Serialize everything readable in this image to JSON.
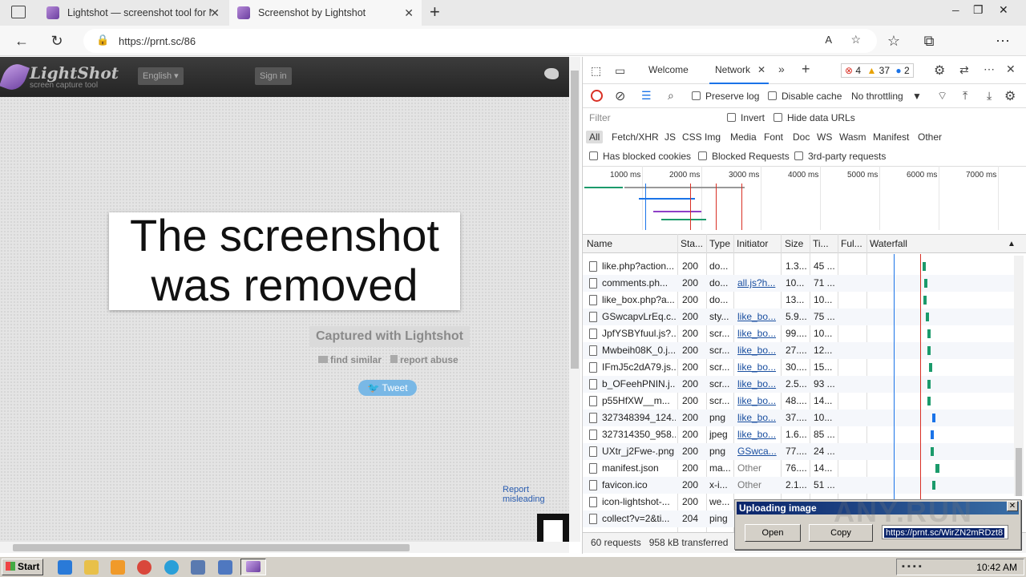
{
  "browser": {
    "tabs": [
      {
        "title": "Lightshot — screenshot tool for M",
        "close": "✕"
      },
      {
        "title": "Screenshot by Lightshot",
        "close": "✕"
      }
    ],
    "new_tab": "+",
    "url": "https://prnt.sc/86",
    "window_controls": [
      "─",
      "❐",
      "✕"
    ]
  },
  "lightshot": {
    "logo": "LightShot",
    "tagline": "screen capture tool",
    "language": "English",
    "sign_in": "Sign in",
    "removed_message_line1": "The screenshot",
    "removed_message_line2": "was removed",
    "captured_with": "Captured with Lightshot",
    "find_similar": "find similar",
    "report_abuse": "report abuse",
    "tweet": "Tweet",
    "report_misleading": "Report misleading"
  },
  "devtools": {
    "tabs": [
      "Welcome",
      "Network"
    ],
    "errors": "4",
    "warnings": "37",
    "info": "2",
    "toolbar": {
      "preserve_log": "Preserve log",
      "disable_cache": "Disable cache",
      "throttling": "No throttling"
    },
    "filter": {
      "placeholder": "Filter",
      "invert": "Invert",
      "hide_data_urls": "Hide data URLs",
      "types": [
        "All",
        "Fetch/XHR",
        "JS",
        "CSS",
        "Img",
        "Media",
        "Font",
        "Doc",
        "WS",
        "Wasm",
        "Manifest",
        "Other"
      ],
      "has_blocked_cookies": "Has blocked cookies",
      "blocked_requests": "Blocked Requests",
      "third_party": "3rd-party requests"
    },
    "overview_ticks": [
      "1000 ms",
      "2000 ms",
      "3000 ms",
      "4000 ms",
      "5000 ms",
      "6000 ms",
      "7000 ms"
    ],
    "columns": [
      "Name",
      "Sta...",
      "Type",
      "Initiator",
      "Size",
      "Ti...",
      "Ful...",
      "Waterfall"
    ],
    "rows": [
      {
        "name": "like.php?action...",
        "status": "200",
        "type": "do...",
        "initiator": "",
        "size": "1.3...",
        "time": "45 ..."
      },
      {
        "name": "comments.ph...",
        "status": "200",
        "type": "do...",
        "initiator": "all.js?h...",
        "size": "10...",
        "time": "71 ..."
      },
      {
        "name": "like_box.php?a...",
        "status": "200",
        "type": "do...",
        "initiator": "",
        "size": "13...",
        "time": "10..."
      },
      {
        "name": "GSwcapvLrEq.c...",
        "status": "200",
        "type": "sty...",
        "initiator": "like_bo...",
        "size": "5.9...",
        "time": "75 ..."
      },
      {
        "name": "JpfYSBYfuul.js?...",
        "status": "200",
        "type": "scr...",
        "initiator": "like_bo...",
        "size": "99....",
        "time": "10..."
      },
      {
        "name": "Mwbeih08K_0.j...",
        "status": "200",
        "type": "scr...",
        "initiator": "like_bo...",
        "size": "27....",
        "time": "12..."
      },
      {
        "name": "IFmJ5c2dA79.js...",
        "status": "200",
        "type": "scr...",
        "initiator": "like_bo...",
        "size": "30....",
        "time": "15..."
      },
      {
        "name": "b_OFeehPNIN.j...",
        "status": "200",
        "type": "scr...",
        "initiator": "like_bo...",
        "size": "2.5...",
        "time": "93 ..."
      },
      {
        "name": "p55HfXW__m...",
        "status": "200",
        "type": "scr...",
        "initiator": "like_bo...",
        "size": "48....",
        "time": "14..."
      },
      {
        "name": "327348394_124...",
        "status": "200",
        "type": "png",
        "initiator": "like_bo...",
        "size": "37....",
        "time": "10..."
      },
      {
        "name": "327314350_958...",
        "status": "200",
        "type": "jpeg",
        "initiator": "like_bo...",
        "size": "1.6...",
        "time": "85 ..."
      },
      {
        "name": "UXtr_j2Fwe-.png",
        "status": "200",
        "type": "png",
        "initiator": "GSwca...",
        "size": "77....",
        "time": "24 ..."
      },
      {
        "name": "manifest.json",
        "status": "200",
        "type": "ma...",
        "initiator": "Other",
        "size": "76....",
        "time": "14..."
      },
      {
        "name": "favicon.ico",
        "status": "200",
        "type": "x-i...",
        "initiator": "Other",
        "size": "2.1...",
        "time": "51 ..."
      },
      {
        "name": "icon-lightshot-...",
        "status": "200",
        "type": "we...",
        "initiator": "",
        "size": "",
        "time": ""
      },
      {
        "name": "collect?v=2&ti...",
        "status": "204",
        "type": "ping",
        "initiator": "",
        "size": "",
        "time": ""
      }
    ],
    "status_bar": "60 requests   958 kB transferred   2.9"
  },
  "upload_dialog": {
    "title": "Uploading image",
    "open": "Open",
    "copy": "Copy",
    "link": "https://prnt.sc/WirZN2mRDzt8",
    "close": "✕"
  },
  "watermark": "ANY.RUN",
  "taskbar": {
    "start": "Start",
    "clock": "10:42 AM"
  }
}
